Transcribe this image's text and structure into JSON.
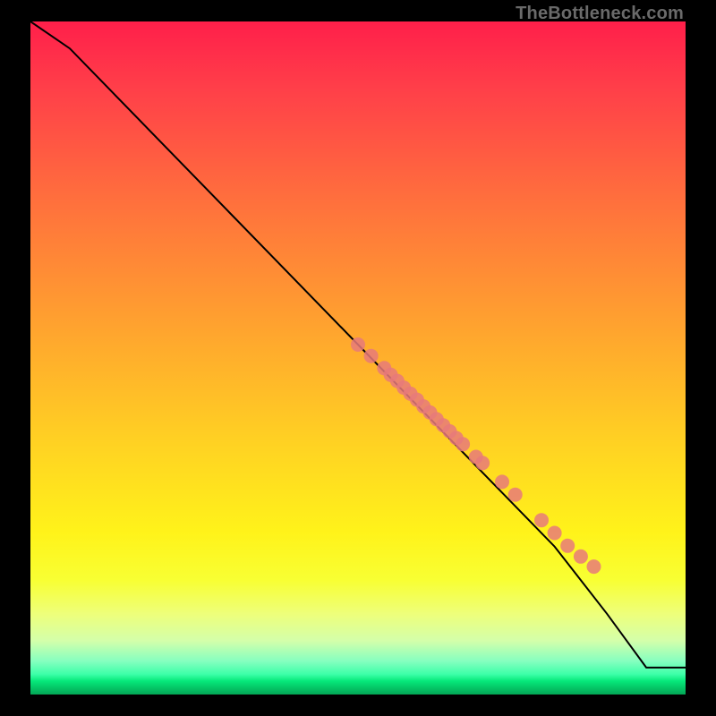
{
  "watermark": "TheBottleneck.com",
  "chart_data": {
    "type": "line",
    "title": "",
    "xlabel": "",
    "ylabel": "",
    "xlim": [
      0,
      100
    ],
    "ylim": [
      0,
      100
    ],
    "series": [
      {
        "name": "curve",
        "x": [
          0,
          6,
          12,
          20,
          30,
          40,
          50,
          60,
          70,
          80,
          88,
          94,
          100
        ],
        "y": [
          100,
          96,
          90,
          82,
          72,
          62,
          52,
          42,
          32,
          22,
          12,
          4,
          4
        ]
      }
    ],
    "scatter": {
      "name": "points",
      "color": "#e77a7a",
      "x": [
        50,
        52,
        54,
        55,
        56,
        57,
        58,
        59,
        60,
        61,
        62,
        63,
        64,
        65,
        66,
        68,
        69,
        72,
        74,
        78,
        80,
        82,
        84,
        86
      ],
      "y": [
        52,
        50.3,
        48.5,
        47.5,
        46.6,
        45.6,
        44.7,
        43.8,
        42.8,
        41.9,
        40.9,
        40.0,
        39.1,
        38.1,
        37.2,
        35.3,
        34.4,
        31.6,
        29.7,
        25.9,
        24.0,
        22.1,
        20.5,
        19.0
      ]
    },
    "gradient_stops": [
      {
        "pos": 0.0,
        "color": "#ff1f4a"
      },
      {
        "pos": 0.45,
        "color": "#ffa22f"
      },
      {
        "pos": 0.8,
        "color": "#fff31a"
      },
      {
        "pos": 0.96,
        "color": "#3cffa8"
      },
      {
        "pos": 1.0,
        "color": "#03a656"
      }
    ]
  }
}
